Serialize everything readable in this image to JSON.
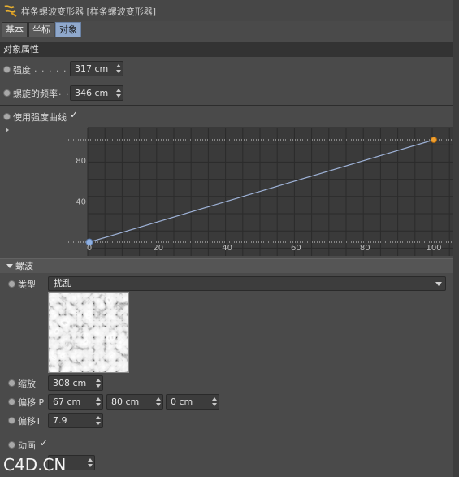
{
  "window": {
    "title": "样条螺波变形器 [样条螺波变形器]"
  },
  "tabs": [
    {
      "label": "基本",
      "active": false
    },
    {
      "label": "坐标",
      "active": false
    },
    {
      "label": "对象",
      "active": true
    }
  ],
  "object_properties": {
    "header": "对象属性",
    "strength_label": "强度",
    "strength_dots": ". . . . . . .",
    "strength_value": "317 cm",
    "frequency_label": "螺旋的频率",
    "frequency_dots": ". .",
    "frequency_value": "346 cm",
    "use_curve_label": "使用强度曲线",
    "use_curve_checked": true,
    "check_glyph": "✓"
  },
  "chart_data": {
    "type": "line",
    "x": [
      0,
      100
    ],
    "y": [
      0,
      100
    ],
    "xlim": [
      0,
      100
    ],
    "ylim": [
      0,
      100
    ],
    "x_ticks": [
      "0",
      "20",
      "40",
      "60",
      "80",
      "100"
    ],
    "y_ticks": [
      "40",
      "80"
    ],
    "grid": true
  },
  "noise": {
    "header": "螺波",
    "type_label": "类型",
    "type_value": "扰乱",
    "scale_label": "缩放",
    "scale_value": "308 cm",
    "offset_p_label": "偏移 P",
    "offset_p_x": "67 cm",
    "offset_p_y": "80 cm",
    "offset_p_z": "0 cm",
    "offset_t_label": "偏移T",
    "offset_t_value": "7.9",
    "animate_label": "动画",
    "animate_checked": true
  },
  "watermark": "C4D.CN",
  "colors": {
    "curve": "#9fb3d8",
    "point_start": "#8fb0e0",
    "point_end": "#f0a030",
    "active_tab": "#8fa8cc"
  }
}
